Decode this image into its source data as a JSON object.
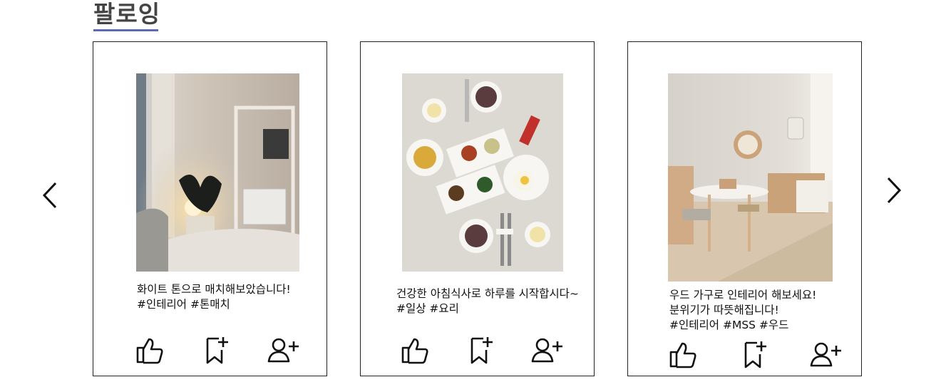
{
  "section": {
    "title": "팔로잉"
  },
  "nav": {
    "prev_icon": "chevron-left-icon",
    "next_icon": "chevron-right-icon"
  },
  "posts": [
    {
      "image": "living-room-interior-photo",
      "caption_lines": [
        "화이트 톤으로 매치해보았습니다!",
        "#인테리어 #톤매치"
      ],
      "actions": [
        "thumbs-up-icon",
        "bookmark-add-icon",
        "follow-user-icon"
      ]
    },
    {
      "image": "korean-breakfast-table-photo",
      "caption_lines": [
        "건강한 아침식사로 하루를 시작합시다~",
        "#일상 #요리"
      ],
      "actions": [
        "thumbs-up-icon",
        "bookmark-add-icon",
        "follow-user-icon"
      ]
    },
    {
      "image": "wooden-kids-room-photo",
      "caption_lines": [
        "우드 가구로 인테리어 해보세요!",
        "분위기가 따뜻해집니다!",
        "#인테리어 #MSS #우드"
      ],
      "actions": [
        "thumbs-up-icon",
        "bookmark-add-icon",
        "follow-user-icon"
      ]
    }
  ],
  "colors": {
    "accent_underline": "#5b6bb5",
    "title": "#444444",
    "border": "#222222"
  }
}
